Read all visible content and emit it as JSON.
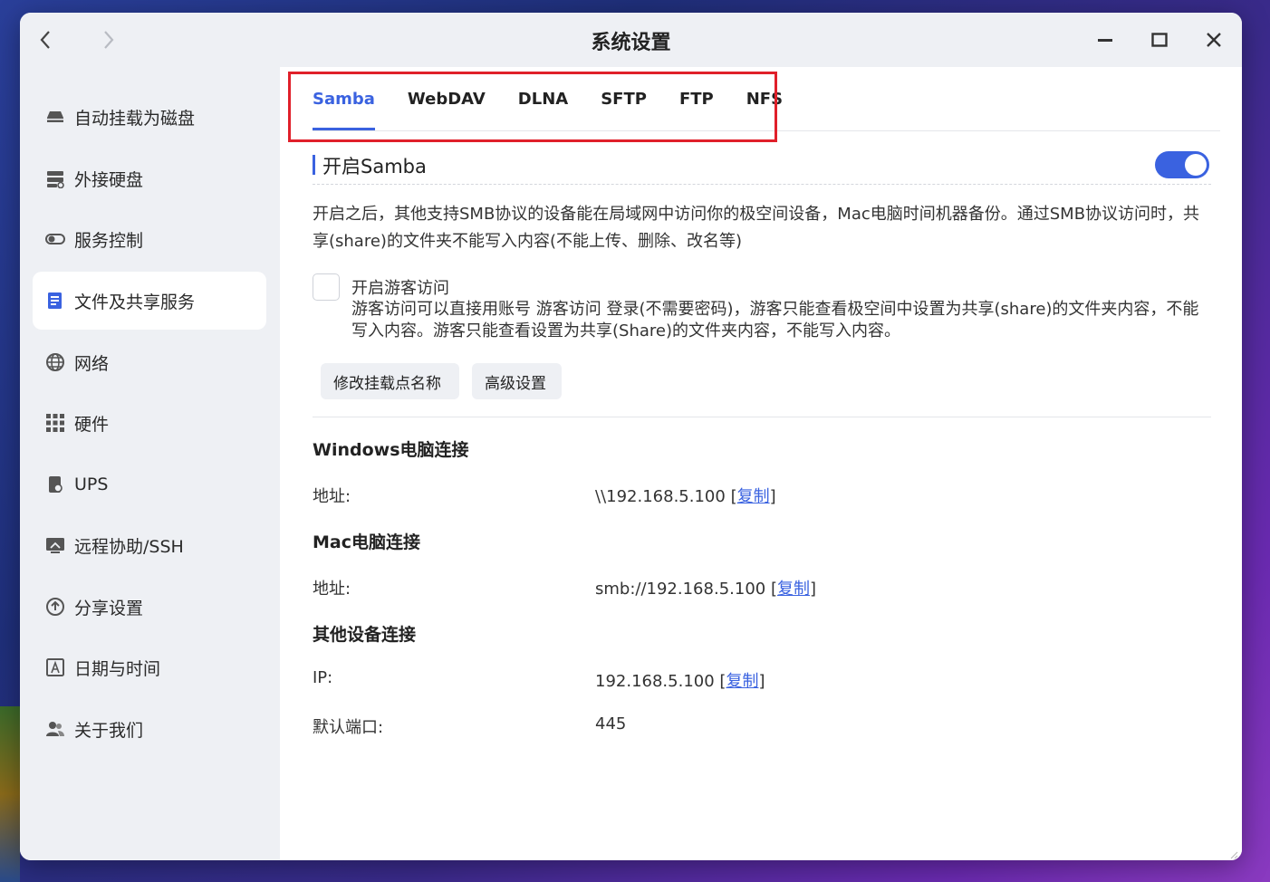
{
  "window": {
    "title": "系统设置"
  },
  "sidebar": {
    "items": [
      {
        "label": "自动挂载为磁盘",
        "icon": "drive-icon"
      },
      {
        "label": "外接硬盘",
        "icon": "external-disk-icon"
      },
      {
        "label": "服务控制",
        "icon": "toggle-icon"
      },
      {
        "label": "文件及共享服务",
        "icon": "file-share-icon",
        "active": true
      },
      {
        "label": "网络",
        "icon": "globe-icon"
      },
      {
        "label": "硬件",
        "icon": "grid-icon"
      },
      {
        "label": "UPS",
        "icon": "ups-icon"
      },
      {
        "label": "远程协助/SSH",
        "icon": "remote-icon"
      },
      {
        "label": "分享设置",
        "icon": "share-icon"
      },
      {
        "label": "日期与时间",
        "icon": "calendar-icon"
      },
      {
        "label": "关于我们",
        "icon": "users-icon"
      }
    ]
  },
  "tabs": [
    {
      "label": "Samba",
      "active": true
    },
    {
      "label": "WebDAV"
    },
    {
      "label": "DLNA"
    },
    {
      "label": "SFTP"
    },
    {
      "label": "FTP"
    },
    {
      "label": "NFS"
    }
  ],
  "samba": {
    "section_title": "开启Samba",
    "enabled": true,
    "description": "开启之后，其他支持SMB协议的设备能在局域网中访问你的极空间设备，Mac电脑时间机器备份。通过SMB协议访问时，共享(share)的文件夹不能写入内容(不能上传、删除、改名等)",
    "guest_title": "开启游客访问",
    "guest_checked": false,
    "guest_desc": "游客访问可以直接用账号 游客访问 登录(不需要密码)，游客只能查看极空间中设置为共享(share)的文件夹内容，不能写入内容。游客只能查看设置为共享(Share)的文件夹内容，不能写入内容。",
    "btn_mount": "修改挂载点名称",
    "btn_advanced": "高级设置"
  },
  "connections": {
    "windows": {
      "heading": "Windows电脑连接",
      "label": "地址:",
      "value": "\\\\192.168.5.100",
      "copy": "复制"
    },
    "mac": {
      "heading": "Mac电脑连接",
      "label": "地址:",
      "value": "smb://192.168.5.100",
      "copy": "复制"
    },
    "other": {
      "heading": "其他设备连接",
      "ip_label": "IP:",
      "ip_value": "192.168.5.100",
      "copy": "复制",
      "port_label": "默认端口:",
      "port_value": "445"
    }
  },
  "colors": {
    "accent": "#3a62e0",
    "highlight": "#e0202a",
    "sidebar_bg": "#eef0f4"
  }
}
